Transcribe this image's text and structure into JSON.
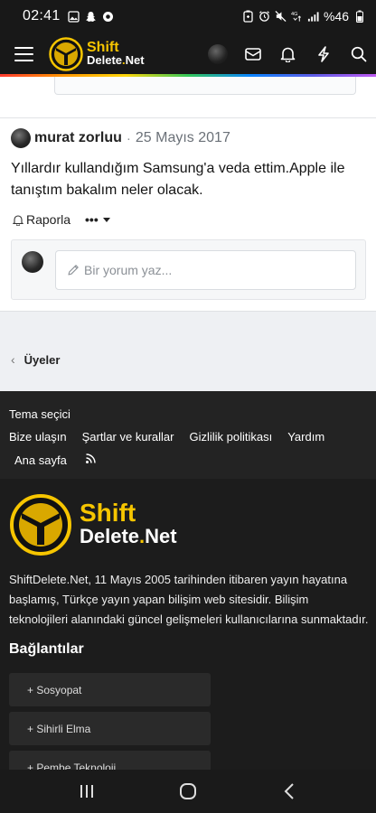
{
  "status_bar": {
    "time": "02:41",
    "battery": "%46",
    "network": "4G",
    "left_icons": [
      "gallery-icon",
      "snapchat-icon",
      "browser-icon"
    ],
    "right_icons": [
      "battery-saver-icon",
      "alarm-icon",
      "mute-icon",
      "wifi-icon",
      "signal-icon"
    ]
  },
  "header": {
    "logo_line1": "Shift",
    "logo_line2": "Delete",
    "logo_dot": ".",
    "logo_suffix": "Net",
    "icons": [
      "avatar",
      "inbox-icon",
      "bell-icon",
      "lightning-icon",
      "search-icon"
    ]
  },
  "post": {
    "author": "murat zorluu",
    "separator": "·",
    "date": "25 Mayıs 2017",
    "body": "Yıllardır kullandığım Samsung'a veda ettim.Apple ile tanıştım bakalım neler olacak.",
    "report_label": "Raporla",
    "more_label": "•••",
    "comment_placeholder": "Bir yorum yaz..."
  },
  "breadcrumb": {
    "chevron": "‹",
    "label": "Üyeler"
  },
  "footer_links": {
    "row1": [
      "Tema seçici"
    ],
    "row2": [
      "Bize ulaşın",
      "Şartlar ve kurallar",
      "Gizlilik politikası",
      "Yardım"
    ],
    "row3": [
      "Ana sayfa"
    ],
    "rss_icon": "rss-icon"
  },
  "footer_about": {
    "logo_line1": "Shift",
    "logo_line2": "Delete",
    "logo_dot": ".",
    "logo_suffix": "Net",
    "description": "ShiftDelete.Net, 11 Mayıs 2005 tarihinden itibaren yayın hayatına başlamış, Türkçe yayın yapan bilişim web sitesidir. Bilişim teknolojileri alanındaki güncel gelişmeleri kullanıcılarına sunmaktadır.",
    "links_title": "Bağlantılar",
    "links": [
      "+ Sosyopat",
      "+ Sihirli Elma",
      "+ Pembe Teknoloji"
    ]
  },
  "nav_bar": {
    "buttons": [
      "recents-icon",
      "home-icon",
      "back-icon"
    ]
  },
  "colors": {
    "brand_yellow": "#f6c500",
    "header_bg": "#181818",
    "footer_bg": "#1c1c1c"
  }
}
